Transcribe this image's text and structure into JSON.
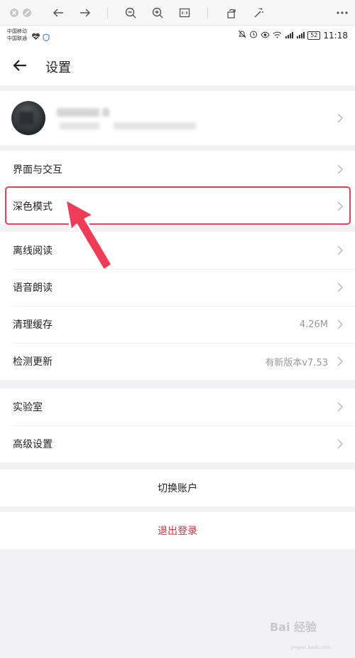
{
  "status": {
    "carrier1": "中国移动",
    "carrier2": "中国联通",
    "battery": "52",
    "time": "11:18"
  },
  "header": {
    "title": "设置"
  },
  "groups": {
    "a": [
      {
        "label": "界面与交互",
        "value": ""
      },
      {
        "label": "深色模式",
        "value": ""
      }
    ],
    "b": [
      {
        "label": "离线阅读",
        "value": ""
      },
      {
        "label": "语音朗读",
        "value": ""
      },
      {
        "label": "清理缓存",
        "value": "4.26M"
      },
      {
        "label": "检测更新",
        "value": "有新版本v7.53"
      }
    ],
    "c": [
      {
        "label": "实验室",
        "value": ""
      },
      {
        "label": "高级设置",
        "value": ""
      }
    ]
  },
  "buttons": {
    "switch_account": "切换账户",
    "logout": "退出登录"
  },
  "colors": {
    "accent_red": "#e8415c",
    "logout_red": "#d9333f",
    "chevron": "#bbbbbb"
  },
  "watermark": {
    "text": "Bai 经验",
    "sub": "jingyan.baidu.com"
  }
}
